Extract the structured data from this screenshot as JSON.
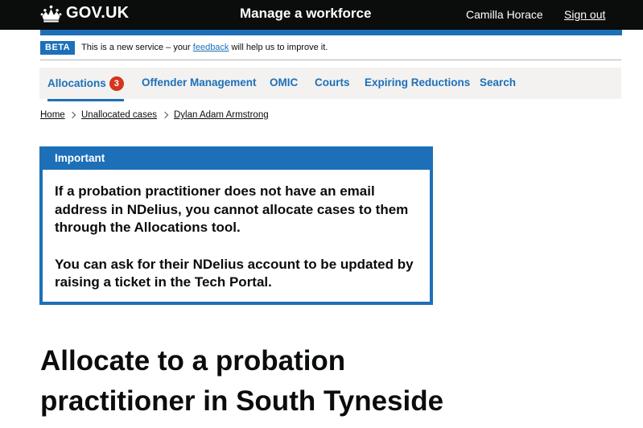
{
  "header": {
    "logo_text": "GOV.UK",
    "service_name": "Manage a workforce",
    "user_name": "Camilla Horace",
    "sign_out_label": "Sign out",
    "crown_icon": "crown-icon"
  },
  "phase_banner": {
    "tag": "BETA",
    "text_before": "This is a new service – your ",
    "link_text": "feedback",
    "text_after": " will help us to improve it."
  },
  "nav": {
    "items": [
      {
        "label": "Allocations",
        "badge": "3",
        "active": true
      },
      {
        "label": "Offender Management"
      },
      {
        "label": "OMIC"
      },
      {
        "label": "Courts"
      },
      {
        "label": "Expiring Reductions"
      },
      {
        "label": "Search"
      }
    ]
  },
  "breadcrumb": {
    "items": [
      "Home",
      "Unallocated cases",
      "Dylan Adam Armstrong"
    ],
    "separator_icon": "chevron-right-icon"
  },
  "important_banner": {
    "title": "Important",
    "paragraph_1": "If a probation practitioner does not have an email address in NDelius, you cannot allocate cases to them through the Allocations tool.",
    "paragraph_2": "You can ask for their NDelius account to be updated by raising a ticket in the Tech Portal."
  },
  "main": {
    "heading": "Allocate to a probation practitioner in South Tyneside"
  },
  "colors": {
    "header_bg": "#0b0c0c",
    "brand_blue": "#1d70b8",
    "badge_red": "#d4351c",
    "nav_bg": "#f3f2f1"
  }
}
